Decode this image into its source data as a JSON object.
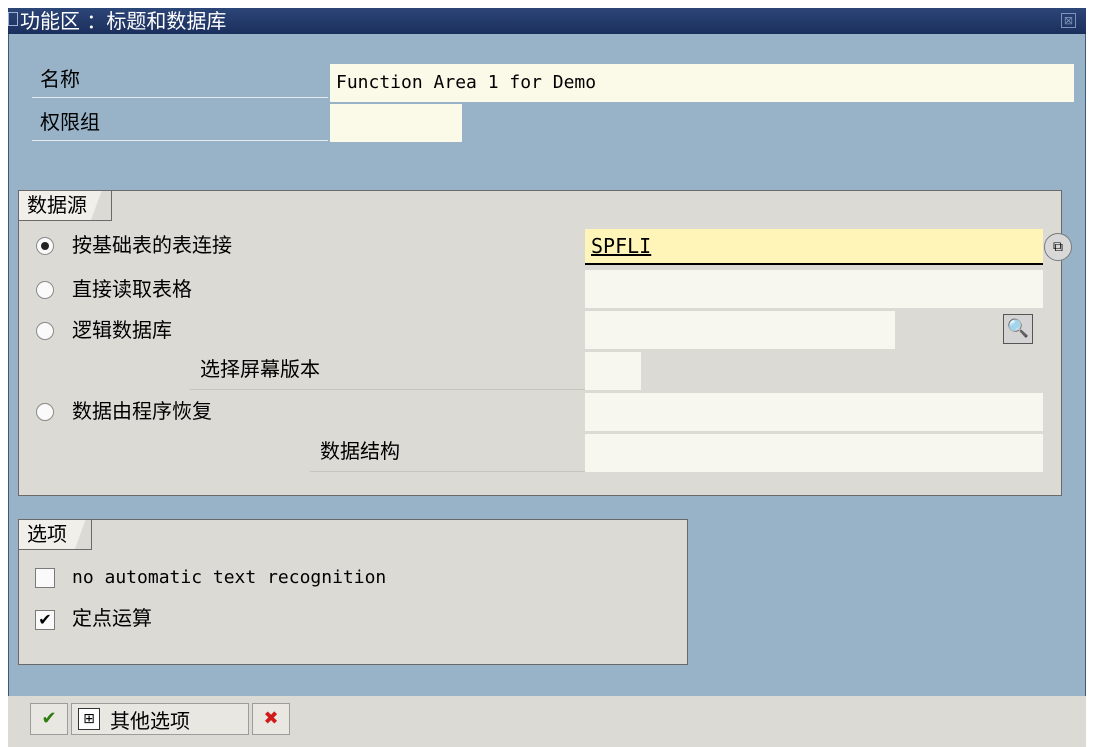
{
  "window": {
    "title": "功能区  ：标题和数据库"
  },
  "header_fields": [
    {
      "label": "名称",
      "value": "Function Area 1 for Demo"
    },
    {
      "label": "权限组",
      "value": ""
    }
  ],
  "datasource": {
    "title": "数据源",
    "options": [
      {
        "label": "按基础表的表连接",
        "selected": true,
        "value": "SPFLI"
      },
      {
        "label": "直接读取表格",
        "selected": false,
        "value": ""
      },
      {
        "label": "逻辑数据库",
        "selected": false,
        "value": ""
      },
      {
        "label": "数据由程序恢复",
        "selected": false,
        "value": ""
      }
    ],
    "screen_version_label": "选择屏幕版本",
    "screen_version_value": "",
    "data_structure_label": "数据结构",
    "data_structure_value": ""
  },
  "options_group": {
    "title": "选项",
    "checkboxes": [
      {
        "label": "no automatic text recognition",
        "checked": false
      },
      {
        "label": "定点运算",
        "checked": true
      }
    ]
  },
  "toolbar": {
    "more_options_label": "其他选项"
  },
  "icons": [
    "window-menu-icon",
    "close-icon",
    "dropdown-help-icon",
    "search-icon",
    "check-icon",
    "add-options-icon",
    "cancel-icon"
  ]
}
